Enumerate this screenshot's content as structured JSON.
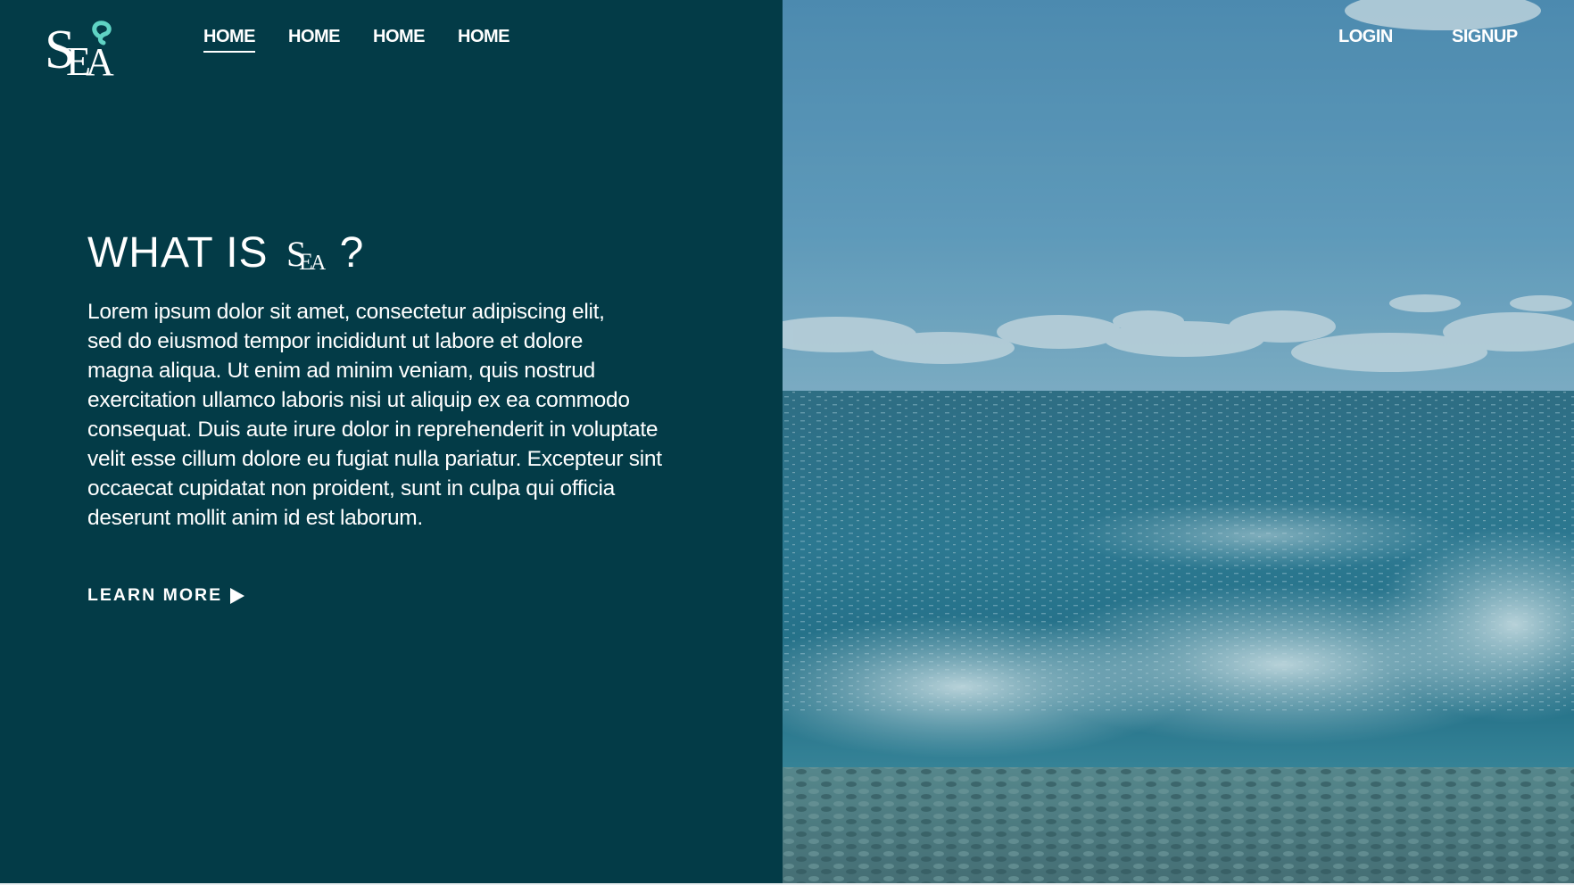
{
  "brand": {
    "logo_text": "SEA",
    "accent_color": "#5fd3c4"
  },
  "nav": {
    "items": [
      {
        "label": "HOME",
        "active": true
      },
      {
        "label": "HOME",
        "active": false
      },
      {
        "label": "HOME",
        "active": false
      },
      {
        "label": "HOME",
        "active": false
      }
    ]
  },
  "auth": {
    "login_label": "LOGIN",
    "signup_label": "SIGNUP"
  },
  "hero": {
    "title_prefix": "WHAT IS",
    "title_suffix": "?",
    "body": "Lorem ipsum dolor sit amet, consectetur adipiscing elit,\n sed do eiusmod tempor incididunt ut labore et dolore\nmagna aliqua. Ut enim ad minim veniam, quis nostrud\nexercitation ullamco laboris nisi ut aliquip ex ea commodo\nconsequat. Duis aute irure dolor in reprehenderit in voluptate\nvelit esse cillum dolore eu fugiat nulla pariatur. Excepteur sint\noccaecat cupidatat non proident, sunt in culpa qui officia\ndeserunt mollit anim id est laborum.",
    "cta_label": "LEARN MORE"
  },
  "colors": {
    "panel_background": "#033b47",
    "text": "#ffffff"
  },
  "image": {
    "subject": "sea-waves-on-pebble-beach"
  }
}
